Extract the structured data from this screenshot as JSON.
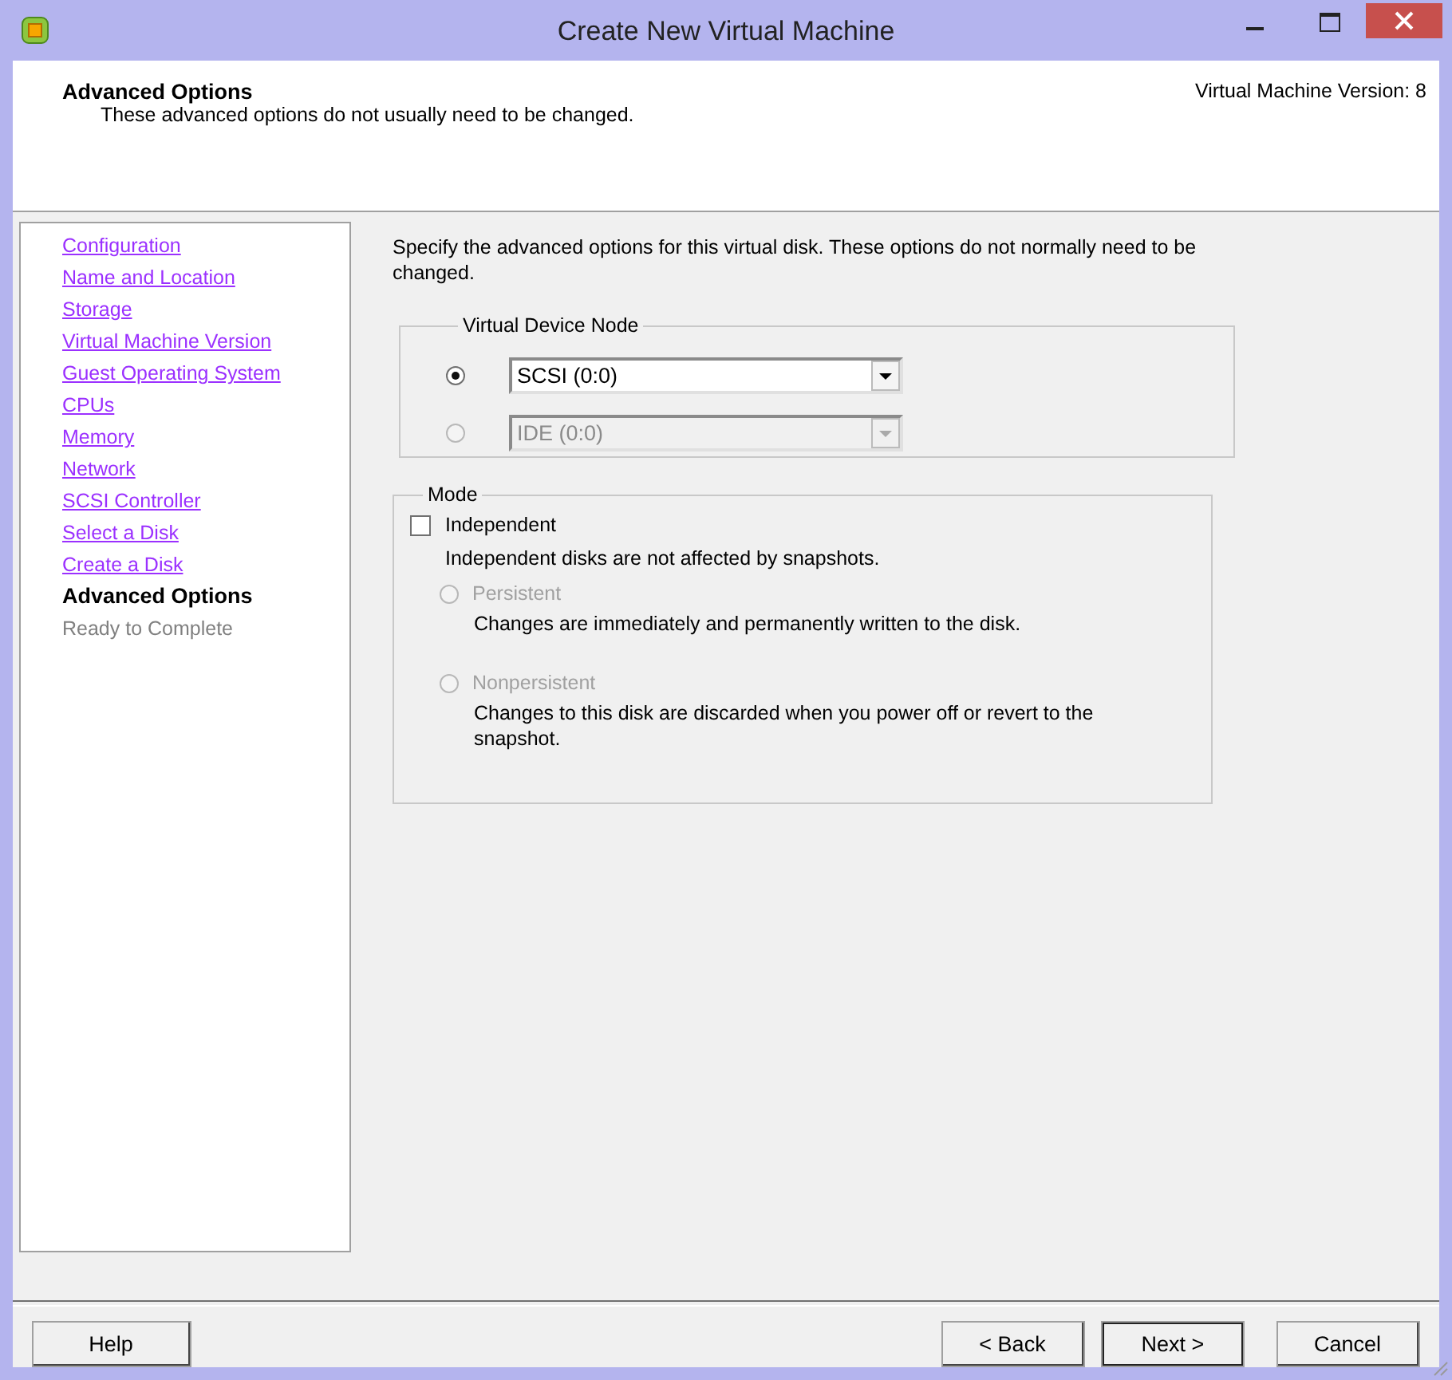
{
  "window": {
    "title": "Create New Virtual Machine"
  },
  "header": {
    "title": "Advanced Options",
    "subtitle": "These advanced options do not usually need to be changed.",
    "version": "Virtual Machine Version: 8"
  },
  "steps": [
    {
      "label": "Configuration",
      "visited": true,
      "current": false
    },
    {
      "label": "Name and Location",
      "visited": true,
      "current": false
    },
    {
      "label": "Storage",
      "visited": true,
      "current": false
    },
    {
      "label": "Virtual Machine Version",
      "visited": true,
      "current": false
    },
    {
      "label": "Guest Operating System",
      "visited": true,
      "current": false
    },
    {
      "label": "CPUs",
      "visited": true,
      "current": false
    },
    {
      "label": "Memory",
      "visited": true,
      "current": false
    },
    {
      "label": "Network",
      "visited": true,
      "current": false
    },
    {
      "label": "SCSI Controller",
      "visited": true,
      "current": false
    },
    {
      "label": "Select a Disk",
      "visited": true,
      "current": false
    },
    {
      "label": "Create a Disk",
      "visited": true,
      "current": false
    },
    {
      "label": "Advanced Options",
      "visited": false,
      "current": true
    },
    {
      "label": "Ready to Complete",
      "visited": false,
      "current": false
    }
  ],
  "intro": "Specify the advanced options for this virtual disk. These options do not normally need to be changed.",
  "device_node": {
    "legend": "Virtual Device Node",
    "options": [
      {
        "value": "SCSI (0:0)",
        "selected": true,
        "disabled": false
      },
      {
        "value": "IDE (0:0)",
        "selected": false,
        "disabled": true
      }
    ]
  },
  "mode": {
    "legend": "Mode",
    "independent": {
      "label": "Independent",
      "checked": false
    },
    "note": "Independent disks are not affected by snapshots.",
    "options": [
      {
        "label": "Persistent",
        "description": "Changes are immediately and permanently written to the disk.",
        "selected": false,
        "disabled": true
      },
      {
        "label": "Nonpersistent",
        "description": "Changes to this disk are discarded when you power off or revert to the snapshot.",
        "selected": false,
        "disabled": true
      }
    ]
  },
  "buttons": [
    {
      "label": "Help",
      "kind": "help",
      "default": false
    },
    {
      "label": "< Back",
      "kind": "nav",
      "default": false
    },
    {
      "label": "Next >",
      "kind": "nav",
      "default": true
    },
    {
      "label": "Cancel",
      "kind": "cancel",
      "default": false
    }
  ]
}
